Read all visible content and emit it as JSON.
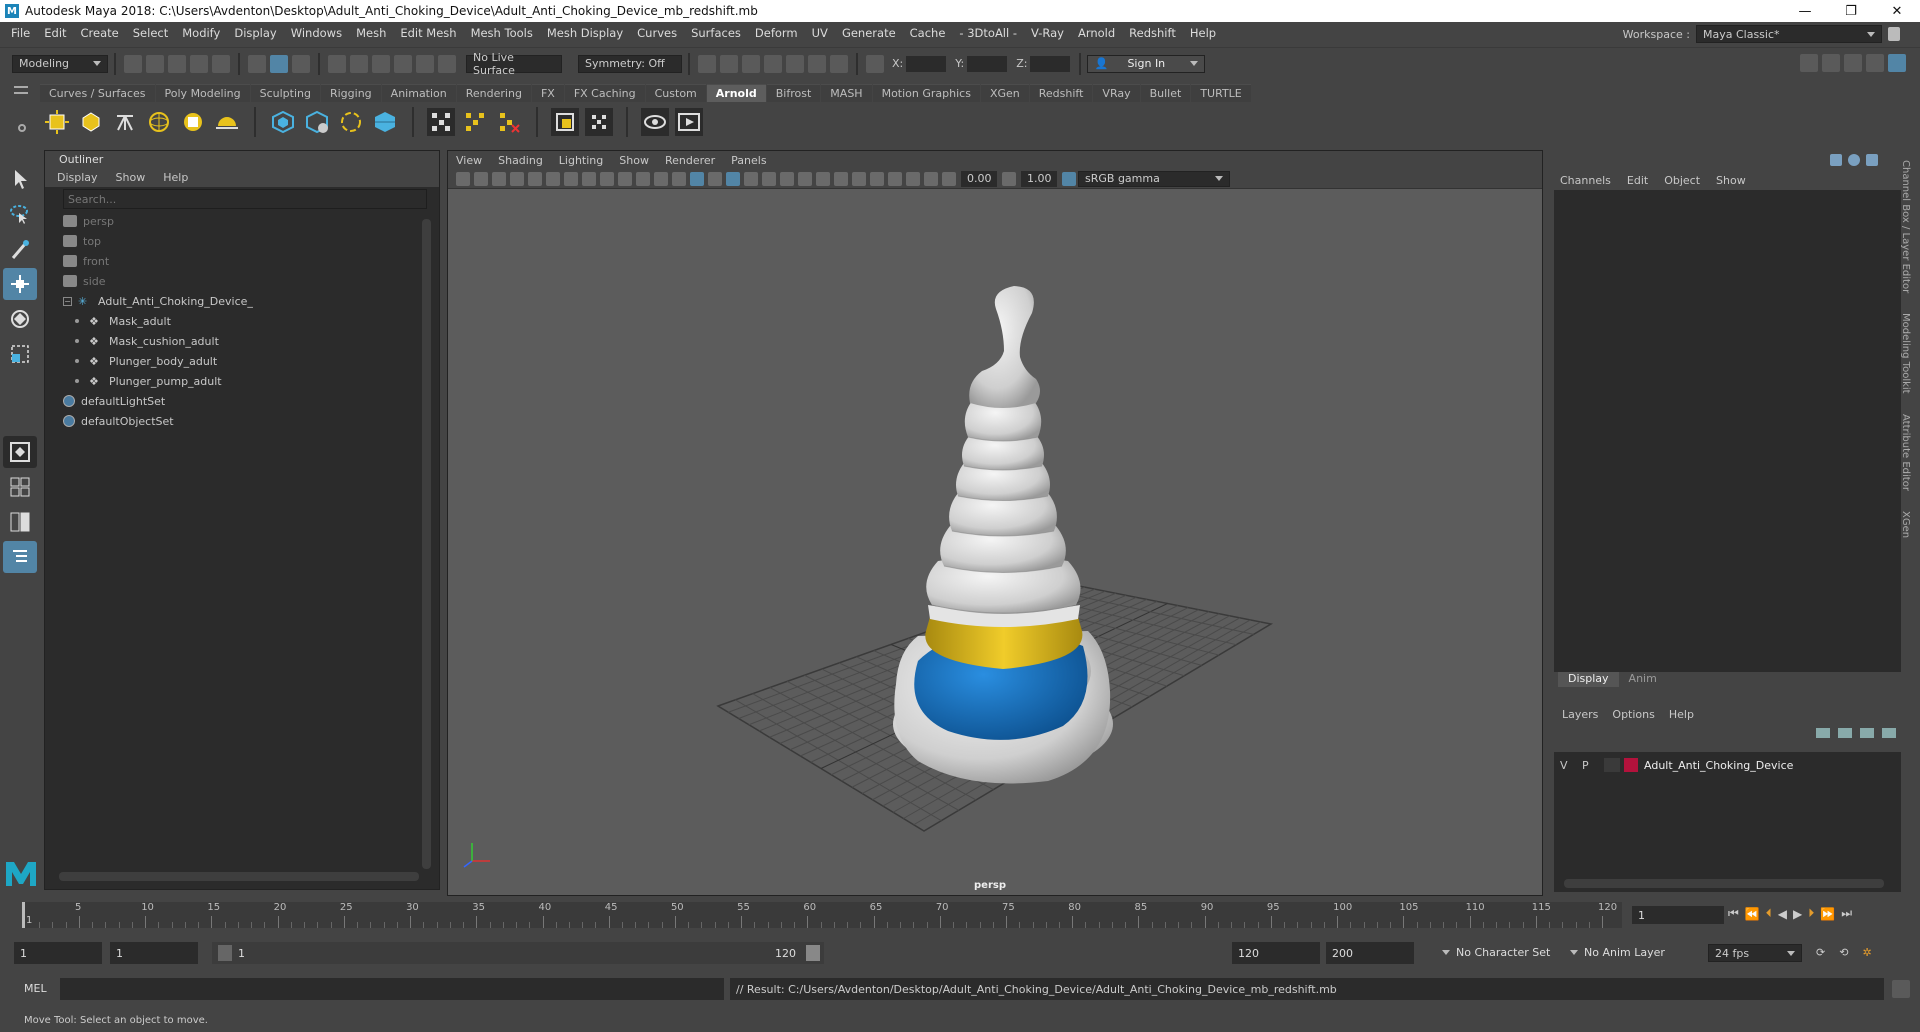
{
  "window": {
    "title": "Autodesk Maya 2018: C:\\Users\\Avdenton\\Desktop\\Adult_Anti_Choking_Device\\Adult_Anti_Choking_Device_mb_redshift.mb",
    "minimize": "—",
    "maximize": "❐",
    "close": "✕"
  },
  "menubar": [
    "File",
    "Edit",
    "Create",
    "Select",
    "Modify",
    "Display",
    "Windows",
    "Mesh",
    "Edit Mesh",
    "Mesh Tools",
    "Mesh Display",
    "Curves",
    "Surfaces",
    "Deform",
    "UV",
    "Generate",
    "Cache",
    "- 3DtoAll -",
    "V-Ray",
    "Arnold",
    "Redshift",
    "Help"
  ],
  "workspace": {
    "label": "Workspace :",
    "value": "Maya Classic*"
  },
  "statusline": {
    "mode": "Modeling",
    "live_surface": "No Live Surface",
    "symmetry": "Symmetry: Off",
    "x_label": "X:",
    "y_label": "Y:",
    "z_label": "Z:",
    "sign_in": "Sign In"
  },
  "shelf_tabs": [
    "Curves / Surfaces",
    "Poly Modeling",
    "Sculpting",
    "Rigging",
    "Animation",
    "Rendering",
    "FX",
    "FX Caching",
    "Custom",
    "Arnold",
    "Bifrost",
    "MASH",
    "Motion Graphics",
    "XGen",
    "Redshift",
    "VRay",
    "Bullet",
    "TURTLE"
  ],
  "active_shelf_tab": "Arnold",
  "outliner": {
    "title": "Outliner",
    "menus": [
      "Display",
      "Show",
      "Help"
    ],
    "search_placeholder": "Search...",
    "items": [
      {
        "label": "persp",
        "dim": true,
        "indent": 0
      },
      {
        "label": "top",
        "dim": true,
        "indent": 0
      },
      {
        "label": "front",
        "dim": true,
        "indent": 0
      },
      {
        "label": "side",
        "dim": true,
        "indent": 0
      },
      {
        "label": "Adult_Anti_Choking_Device_",
        "dim": false,
        "indent": 0
      },
      {
        "label": "Mask_adult",
        "dim": false,
        "indent": 1
      },
      {
        "label": "Mask_cushion_adult",
        "dim": false,
        "indent": 1
      },
      {
        "label": "Plunger_body_adult",
        "dim": false,
        "indent": 1
      },
      {
        "label": "Plunger_pump_adult",
        "dim": false,
        "indent": 1
      },
      {
        "label": "defaultLightSet",
        "dim": false,
        "indent": 0
      },
      {
        "label": "defaultObjectSet",
        "dim": false,
        "indent": 0
      }
    ]
  },
  "viewport": {
    "menus": [
      "View",
      "Shading",
      "Lighting",
      "Show",
      "Renderer",
      "Panels"
    ],
    "exposure": "0.00",
    "gamma": "1.00",
    "color_space": "sRGB gamma",
    "camera_label": "persp"
  },
  "channelbox": {
    "menus": [
      "Channels",
      "Edit",
      "Object",
      "Show"
    ],
    "side_tabs": [
      "Channel Box / Layer Editor",
      "Modeling Toolkit",
      "Attribute Editor",
      "XGen"
    ]
  },
  "layer_editor": {
    "tabs": [
      "Display",
      "Anim"
    ],
    "menus": [
      "Layers",
      "Options",
      "Help"
    ],
    "layer": {
      "v": "V",
      "p": "P",
      "name": "Adult_Anti_Choking_Device",
      "color": "#b3123c"
    }
  },
  "timeline": {
    "ticks": [
      "5",
      "10",
      "15",
      "20",
      "25",
      "30",
      "35",
      "40",
      "45",
      "50",
      "55",
      "60",
      "65",
      "70",
      "75",
      "80",
      "85",
      "90",
      "95",
      "100",
      "105",
      "110",
      "115",
      "120"
    ],
    "current_frame": "1",
    "marker": "1"
  },
  "range": {
    "start": "1",
    "playback_start": "1",
    "slider_start": "1",
    "slider_end": "120",
    "playback_end": "120",
    "end": "200",
    "character_set": "No Character Set",
    "anim_layer": "No Anim Layer",
    "fps": "24 fps"
  },
  "cmdline": {
    "lang": "MEL",
    "result": "// Result: C:/Users/Avdenton/Desktop/Adult_Anti_Choking_Device/Adult_Anti_Choking_Device_mb_redshift.mb"
  },
  "helpline": "Move Tool: Select an object to move.",
  "colors": {
    "accent": "#5285a6",
    "mask_blue": "#1c6fb8",
    "ring_yellow": "#d8b21a"
  }
}
